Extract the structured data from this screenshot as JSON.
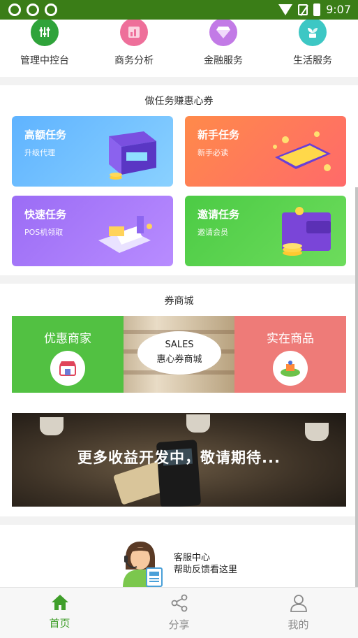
{
  "status_bar": {
    "time": "9:07"
  },
  "quick_nav": [
    {
      "label": "管理中控台",
      "icon": "sliders-icon",
      "color": "#2fa33a"
    },
    {
      "label": "商务分析",
      "icon": "analysis-icon",
      "color": "#ee6f9a"
    },
    {
      "label": "金融服务",
      "icon": "diamond-icon",
      "color": "#c27ae6"
    },
    {
      "label": "生活服务",
      "icon": "plant-icon",
      "color": "#3dc7c4"
    }
  ],
  "tasks": {
    "title": "做任务赚惠心券",
    "cards": [
      {
        "title": "高额任务",
        "subtitle": "升级代理",
        "color_from": "#5fb3ff",
        "color_to": "#8ad1ff"
      },
      {
        "title": "新手任务",
        "subtitle": "新手必读",
        "color_from": "#ff8a4a",
        "color_to": "#ff6a6a"
      },
      {
        "title": "快速任务",
        "subtitle": "POS机领取",
        "color_from": "#9b6cf5",
        "color_to": "#b88cff"
      },
      {
        "title": "邀请任务",
        "subtitle": "邀请会员",
        "color_from": "#4ccb45",
        "color_to": "#6ddc5c"
      }
    ]
  },
  "mall": {
    "title": "券商城",
    "left_label": "优惠商家",
    "center_line1": "SALES",
    "center_line2": "惠心券商城",
    "right_label": "实在商品"
  },
  "banner": {
    "text": "更多收益开发中，敬请期待..."
  },
  "service": {
    "line1": "客服中心",
    "line2": "帮助反馈看这里"
  },
  "tabs": [
    {
      "label": "首页",
      "icon": "home-icon",
      "active": true
    },
    {
      "label": "分享",
      "icon": "share-icon",
      "active": false
    },
    {
      "label": "我的",
      "icon": "user-icon",
      "active": false
    }
  ]
}
